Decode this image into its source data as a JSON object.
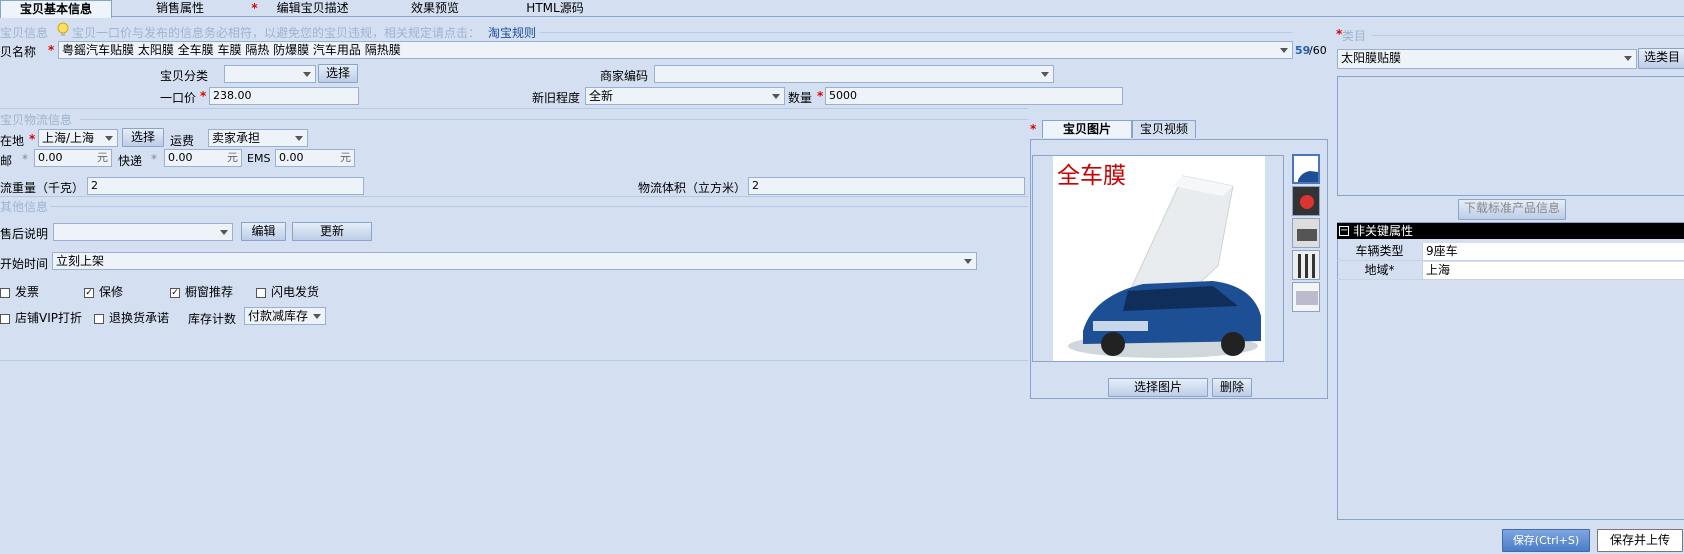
{
  "tabs": [
    {
      "label": "宝贝基本信息",
      "active": true,
      "required": false
    },
    {
      "label": "销售属性",
      "active": false,
      "required": false
    },
    {
      "label": "编辑宝贝描述",
      "active": false,
      "required": true
    },
    {
      "label": "效果预览",
      "active": false,
      "required": false
    },
    {
      "label": "HTML源码",
      "active": false,
      "required": false
    }
  ],
  "required_mark": "*",
  "item_info": {
    "section_title": "宝贝信息",
    "notice": "宝贝一口价与发布的信息务必相符，以避免您的宝贝违规，相关规定请点击：",
    "rules_link": "淘宝规则",
    "name_label": "贝名称",
    "name_value": "粤鎐汽车贴膜 太阳膜 全车膜 车膜 隔热 防爆膜 汽车用品 隔热膜",
    "name_count": "59",
    "name_max": "/60",
    "category_label": "宝贝分类",
    "category_value": "",
    "select_button": "选择",
    "merchant_code_label": "商家编码",
    "merchant_code_value": "",
    "price_label": "一口价",
    "price_value": "238.00",
    "condition_label": "新旧程度",
    "condition_value": "全新",
    "quantity_label": "数量",
    "quantity_value": "5000"
  },
  "logistics": {
    "section_title": "宝贝物流信息",
    "location_label": "在地",
    "location_value": "上海/上海",
    "select_button": "选择",
    "freight_label": "运费",
    "freight_value": "卖家承担",
    "mail_label": "邮",
    "mail_value": "0.00",
    "express_label": "快递",
    "express_value": "0.00",
    "ems_label": "EMS",
    "ems_value": "0.00",
    "currency_unit": "元",
    "weight_label": "流重量（千克）",
    "weight_value": "2",
    "volume_label": "物流体积（立方米）",
    "volume_value": "2"
  },
  "other": {
    "section_title": "其他信息",
    "after_sale_label": "售后说明",
    "after_sale_value": "",
    "edit_button": "编辑",
    "update_button": "更新",
    "start_time_label": "开始时间",
    "start_time_value": "立刻上架",
    "checkboxes_row1": [
      {
        "label": "发票",
        "checked": false
      },
      {
        "label": "保修",
        "checked": true
      },
      {
        "label": "橱窗推荐",
        "checked": true
      },
      {
        "label": "闪电发货",
        "checked": false
      }
    ],
    "checkboxes_row2": [
      {
        "label": "店铺VIP打折",
        "checked": false
      },
      {
        "label": "退换货承诺",
        "checked": false
      }
    ],
    "stock_label": "库存计数",
    "stock_value": "付款减库存"
  },
  "media": {
    "tab_images": "宝贝图片",
    "tab_video": "宝贝视频",
    "image_caption": "全车膜",
    "select_image_button": "选择图片",
    "delete_button": "删除"
  },
  "category_panel": {
    "title": "类目",
    "value": "太阳膜贴膜",
    "choose_button": "选类目",
    "download_button": "下载标准产品信息",
    "props_header": "非关键属性",
    "props": [
      {
        "name": "车辆类型",
        "value": "9座车"
      },
      {
        "name": "地域*",
        "value": "上海"
      }
    ]
  },
  "footer": {
    "save_button": "保存(Ctrl+S)",
    "save_upload_button": "保存并上传"
  },
  "colors": {
    "background": "#d4e0f1",
    "required": "#dd0000",
    "link": "#1a4e9c",
    "count": "#2a5ea8"
  }
}
